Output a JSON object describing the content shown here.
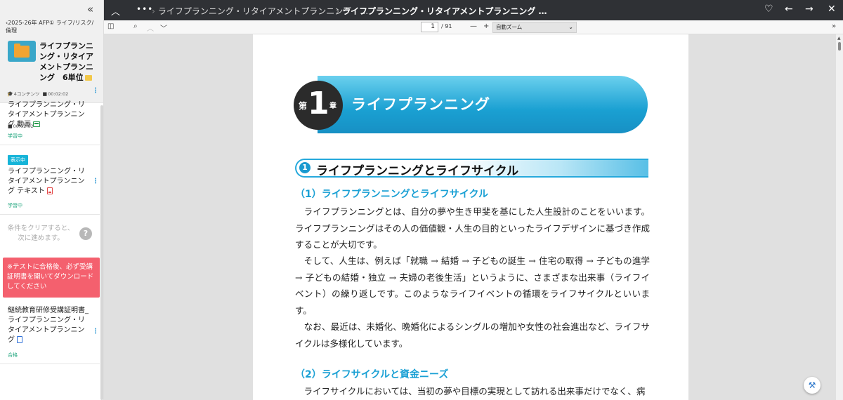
{
  "sidebar": {
    "collapse_glyph": "«",
    "breadcrumb": "‹2025-26年 AFP① ライフ/リスク/倫理",
    "course": {
      "title": "ライフプランニング・リタイアメントプランニング　6単位",
      "content_count": "4コンテンツ",
      "duration": "00:02:02"
    },
    "items": [
      {
        "title": "ライフプランニング・リタイアメントプランニング 動画",
        "duration": "00:02:02",
        "status": "学習中",
        "icon": "video-icon"
      },
      {
        "badge": "表示中",
        "title": "ライフプランニング・リタイアメントプランニング テキスト",
        "status": "学習中",
        "icon": "pdf-icon"
      },
      {
        "locked_text": "条件をクリアすると、次に進めます。",
        "help_glyph": "?"
      },
      {
        "title": "継続教育研修受講証明書_ライフプランニング・リタイアメントプランニング",
        "status": "合格",
        "icon": "certificate-icon"
      }
    ],
    "alert": "※テストに合格後、必ず受講証明書を開いてダウンロードしてください"
  },
  "topbar": {
    "crumb_parent": "ライフプランニング・リタイアメントプランニング　…",
    "crumb_current": "ライフプランニング・リタイアメントプランニング …",
    "icons": [
      "chevron-up-icon",
      "more-icon",
      "heart-icon",
      "arrow-left-icon",
      "arrow-right-icon",
      "close-icon"
    ]
  },
  "pdf_toolbar": {
    "page_current": "1",
    "page_total": "/ 91",
    "zoom": "自動ズーム"
  },
  "document": {
    "chapter_prefix": "第",
    "chapter_number": "1",
    "chapter_suffix": "章",
    "chapter_title": "ライフプランニング",
    "section_number": "1",
    "section_title": "ライフプランニングとライフサイクル",
    "sub1_title": "（1）ライフプランニングとライフサイクル",
    "para1": "　ライフプランニングとは、自分の夢や生き甲斐を基にした人生設計のことをいいます。ライフプランニングはその人の価値観・人生の目的といったライフデザインに基づき作成することが大切です。",
    "para2": "　そして、人生は、例えば「就職 → 結婚 → 子どもの誕生 → 住宅の取得 → 子どもの進学 → 子どもの結婚・独立 → 夫婦の老後生活」というように、さまざまな出来事（ライフイベント）の繰り返しです。このようなライフイベントの循環をライフサイクルといいます。",
    "para3": "　なお、最近は、未婚化、晩婚化によるシングルの増加や女性の社会進出など、ライフサイクルは多様化しています。",
    "sub2_title": "（2）ライフサイクルと資金ニーズ",
    "para4": "　ライフサイクルにおいては、当初の夢や目標の実現として訪れる出来事だけでなく、病"
  }
}
